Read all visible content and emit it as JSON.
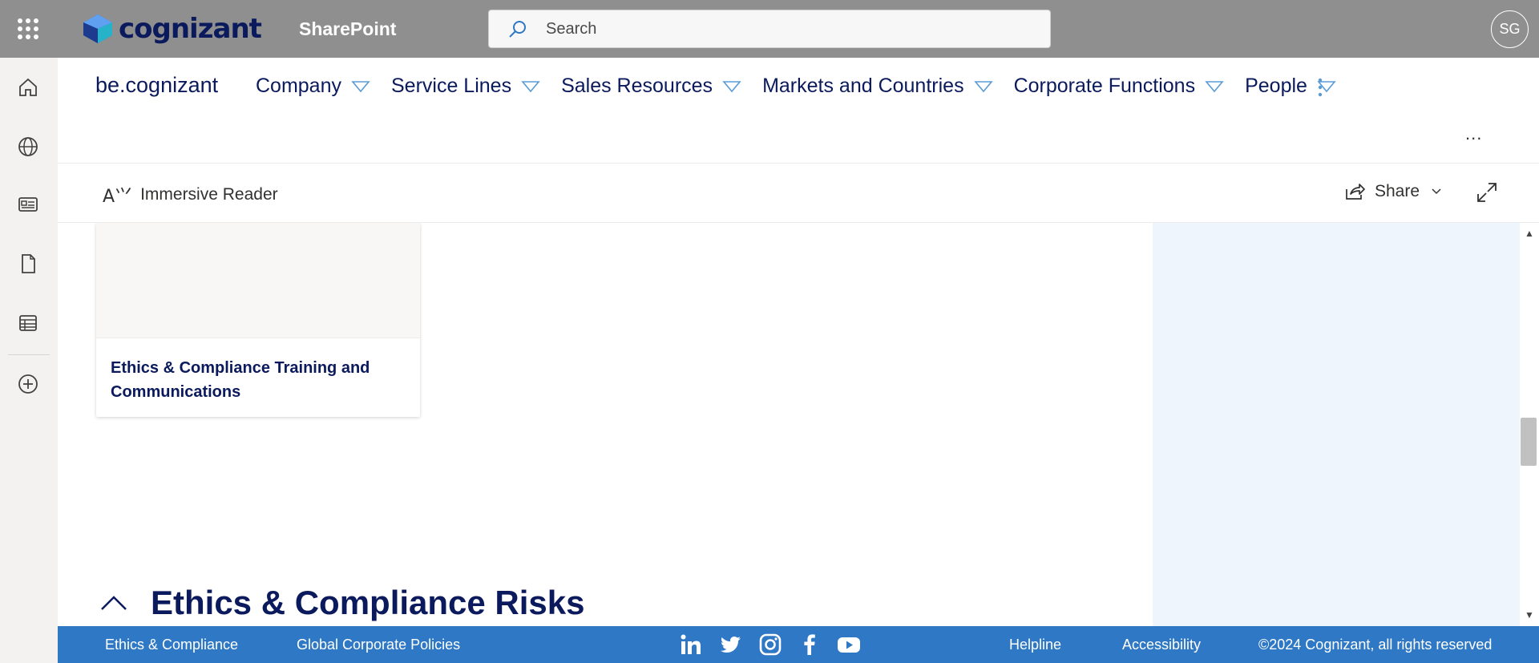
{
  "suite_bar": {
    "brand_name": "cognizant",
    "app_name": "SharePoint",
    "search_placeholder": "Search",
    "avatar_initials": "SG"
  },
  "hub_nav": {
    "site_title": "be.cognizant",
    "items": [
      {
        "label": "Company"
      },
      {
        "label": "Service Lines"
      },
      {
        "label": "Sales Resources"
      },
      {
        "label": "Markets and Countries"
      },
      {
        "label": "Corporate Functions"
      },
      {
        "label": "People"
      }
    ],
    "page_more": "..."
  },
  "command_bar": {
    "immersive_reader": "Immersive Reader",
    "share": "Share"
  },
  "content": {
    "card_title": "Ethics & Compliance Training and Communications",
    "section_title": "Ethics & Compliance Risks"
  },
  "footer": {
    "left_links": [
      "Ethics & Compliance",
      "Global Corporate Policies"
    ],
    "right_links": [
      "Helpline",
      "Accessibility"
    ],
    "copyright": "©2024 Cognizant, all rights reserved",
    "social_icons": [
      "linkedin-icon",
      "twitter-icon",
      "instagram-icon",
      "facebook-icon",
      "youtube-icon"
    ]
  },
  "colors": {
    "suite_bar": "#8f8f8f",
    "brand_navy": "#0b1a5c",
    "footer_blue": "#2e78c5",
    "right_pane": "#eef5fc",
    "nav_caret": "#5b9bd5"
  }
}
